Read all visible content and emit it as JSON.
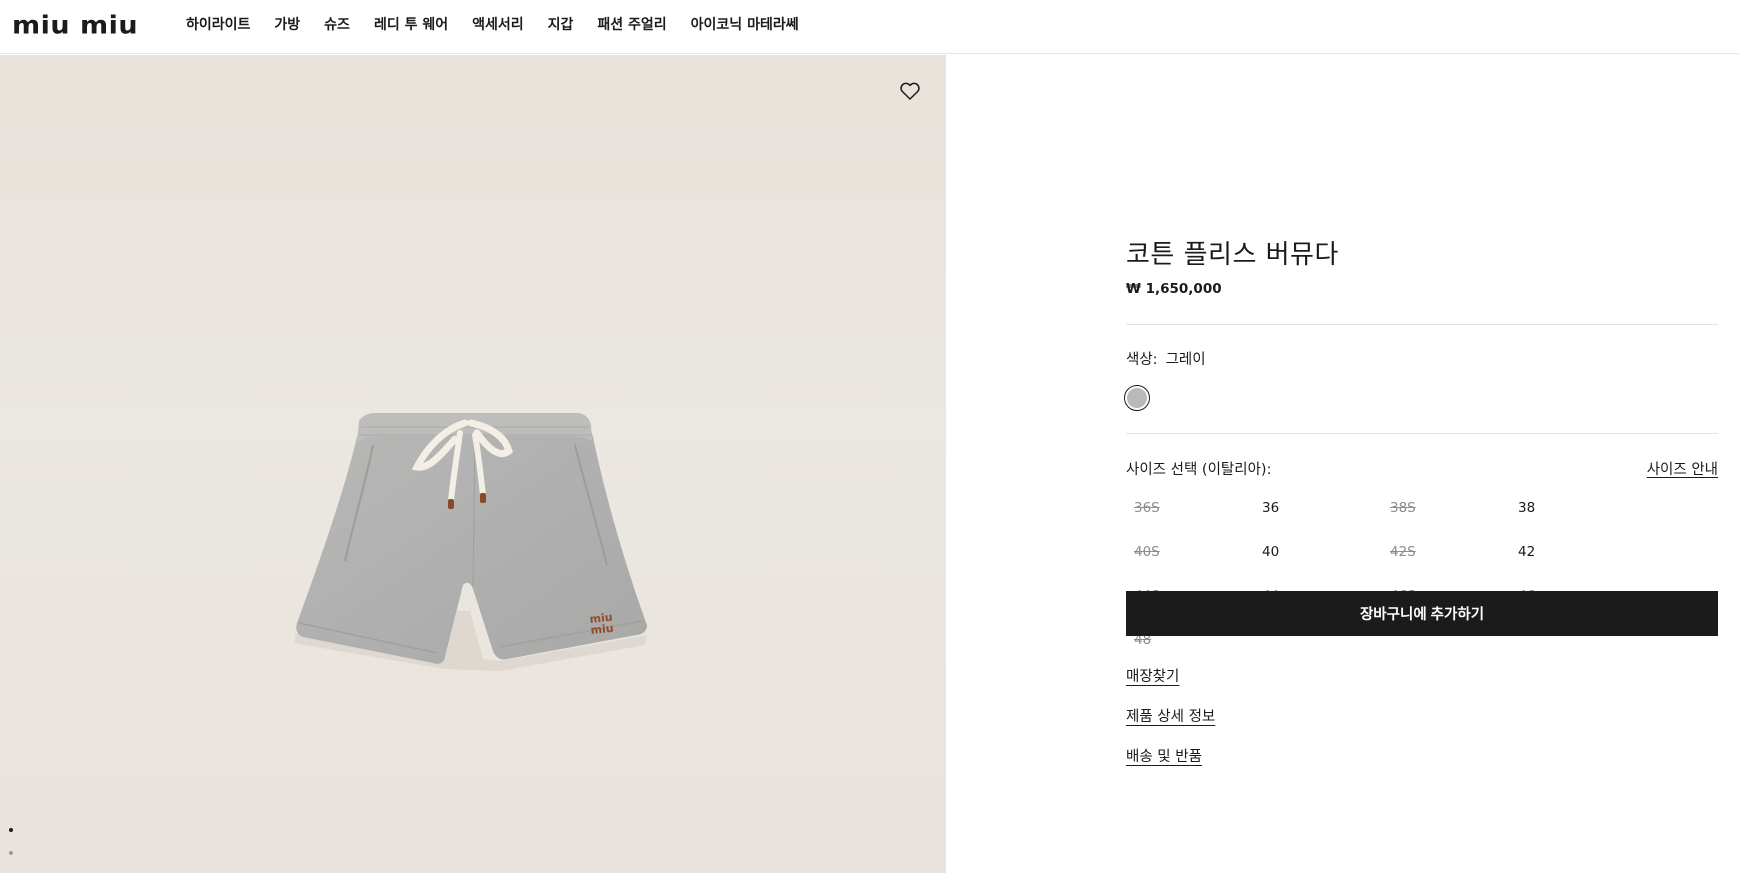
{
  "header": {
    "logo": "miu miu",
    "nav": [
      "하이라이트",
      "가방",
      "슈즈",
      "레디 투 웨어",
      "액세서리",
      "지갑",
      "패션 주얼리",
      "아이코닉 마테라쎄"
    ]
  },
  "media": {
    "image_alt": "grey cotton fleece shorts",
    "wishlist_icon": "heart-outline-icon",
    "carousel_dots": 2,
    "active_dot": 0
  },
  "product": {
    "title": "코튼 플리스 버뮤다",
    "price": "₩ 1,650,000",
    "color_label": "색상:",
    "color_value": "그레이",
    "swatch_color": "#b9b9b9",
    "size_label": "사이즈 선택 (이탈리아):",
    "size_guide": "사이즈 안내",
    "sizes": [
      {
        "label": "36S",
        "available": false
      },
      {
        "label": "36",
        "available": true
      },
      {
        "label": "38S",
        "available": false
      },
      {
        "label": "38",
        "available": true
      },
      {
        "label": "40S",
        "available": false
      },
      {
        "label": "40",
        "available": true
      },
      {
        "label": "42S",
        "available": false
      },
      {
        "label": "42",
        "available": true
      },
      {
        "label": "44S",
        "available": false
      },
      {
        "label": "44",
        "available": false
      },
      {
        "label": "46S",
        "available": false
      },
      {
        "label": "46",
        "available": false
      },
      {
        "label": "48",
        "available": false
      }
    ],
    "add_to_cart": "장바구니에 추가하기",
    "links": [
      "매장찾기",
      "제품 상세 정보",
      "배송 및 반품"
    ]
  }
}
